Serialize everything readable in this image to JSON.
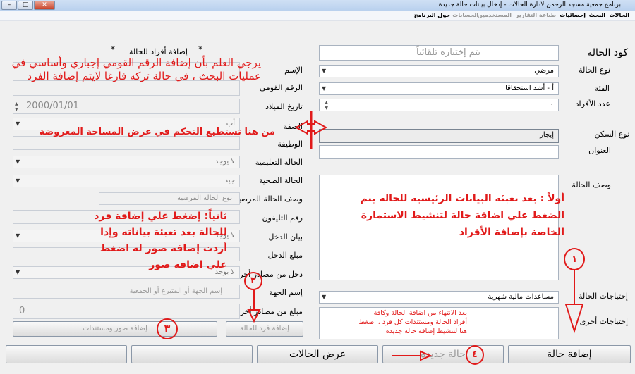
{
  "window": {
    "title": "برنامج جمعية مسجد الرحمن لادارة الحالات - إدخال بيانات حالة جديدة"
  },
  "menu": [
    "الحالات",
    "البحث",
    "إحصائيات",
    "طباعة التقارير",
    "المستخدمين",
    "الحسابات",
    "حول البرنامج"
  ],
  "case": {
    "code_label": "كود الحالة",
    "code_placeholder": "يتم إختياره تلقائياً",
    "type_label": "نوع الحالة",
    "type_value": "مرضي",
    "category_label": "الفئة",
    "category_value": "أ - أشد استحقاقا",
    "members_label": "عدد الأفراد",
    "members_value": "٠",
    "housing_label": "نوع السكن",
    "housing_value": "إيجار",
    "address_label": "العنوان",
    "description_label": "وصف الحالة",
    "needs_label": "إحتياجات الحالة",
    "needs_value": "مساعدات مالية شهرية",
    "other_needs_label": "إحتياجات أخرى"
  },
  "member": {
    "section_title": "إضافة أفراد للحالة",
    "star": "*",
    "name_label": "الإسم",
    "national_id_label": "الرقم القومي",
    "birth_label": "تاريخ الميلاد",
    "birth_value": "2000/01/01",
    "relation_label": "الصفة",
    "relation_value": "أب",
    "job_label": "الوظيفة",
    "education_label": "الحالة التعليمية",
    "education_value": "لا يوجد",
    "health_label": "الحالة الصحية",
    "health_value": "جيد",
    "health_desc_label": "وصف الحالة المرضية",
    "health_desc_value": "نوع الحالة المرضية",
    "phone_label": "رقم التليفون",
    "income_label": "بيان الدخل",
    "income_value": "لا يوجد",
    "income_amount_label": "مبلغ الدخل",
    "other_income_label": "دخل من مصادر أخرى",
    "other_income_value": "لا يوجد",
    "entity_label": "إسم الجهة",
    "entity_placeholder": "إسم الجهة أو المتبرع أو الجمعية",
    "other_amount_label": "مبلغ من مصادر أخرى",
    "other_amount_value": "0",
    "add_member_button": "إضافة فرد للحالة",
    "add_images_button": "إضافة صور ومستندات"
  },
  "buttons": {
    "add_case": "إضافة حالة",
    "new_case": "حالة جديدة",
    "show_cases": "عرض الحالات"
  },
  "notes": {
    "n1_line1": "يرجي العلم بأن إضافة الرقم القومي إجباري وأساسي في",
    "n1_line2": "عمليات البحث ، في حالة تركه فارغا لايتم إضافة الفرد",
    "n2": "من هنا تستطيع التحكم في عرض المساحة المعروضة",
    "n3_line1": "أولاً : بعد تعبئة البيانات الرئيسية للحالة يتم",
    "n3_line2": "الضغط علي اضافة حالة لتنشيط الاستمارة",
    "n3_line3": "الخاصة بإضافة الأفراد",
    "n4_line1": "ثانياً: إضغط علي إضافة فرد",
    "n4_line2": "للحالة بعد تعبئة بياناته وإذا",
    "n4_line3": "أردت إضافة صور له اضغط",
    "n4_line4": "علي اضافة صور",
    "n5_line1": "بعد الانتهاء من اضافة الحالة وكافة",
    "n5_line2": "أفراد الحالة ومستندات كل فرد ، اضغط",
    "n5_line3": "هنا لتنشيط إضافة حالة جديدة"
  },
  "circles": [
    "١",
    "٢",
    "٣",
    "٤"
  ],
  "colors": {
    "annotation": "#e11a1a",
    "window_bg": "#f0f0f0"
  }
}
